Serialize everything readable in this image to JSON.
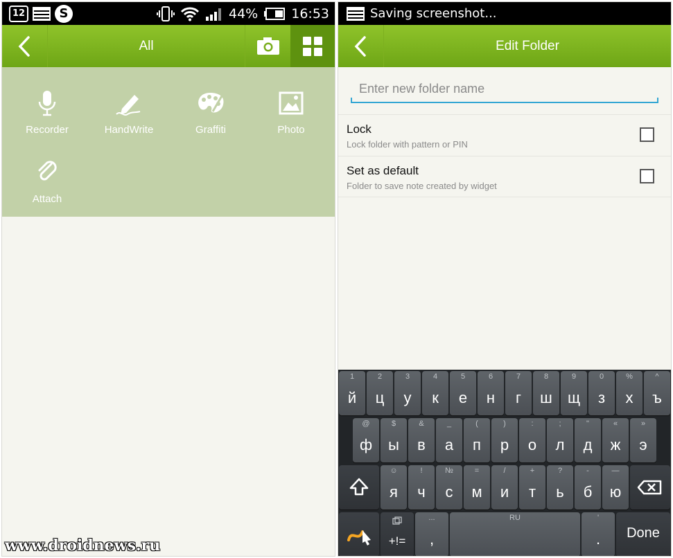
{
  "left": {
    "status": {
      "calendar_day": "12",
      "battery_percent": "44%",
      "time": "16:53",
      "s_icon_letter": "S"
    },
    "appbar": {
      "title": "All"
    },
    "tools": [
      {
        "label": "Recorder",
        "icon": "microphone-icon"
      },
      {
        "label": "HandWrite",
        "icon": "pen-icon"
      },
      {
        "label": "Graffiti",
        "icon": "palette-icon"
      },
      {
        "label": "Photo",
        "icon": "image-icon"
      },
      {
        "label": "Attach",
        "icon": "paperclip-icon"
      }
    ],
    "watermark": "www.droidnews.ru"
  },
  "right": {
    "status": {
      "text": "Saving screenshot..."
    },
    "appbar": {
      "title": "Edit Folder"
    },
    "folder_name": {
      "value": "",
      "placeholder": "Enter new folder name"
    },
    "options": [
      {
        "title": "Lock",
        "subtitle": "Lock folder with pattern or PIN",
        "checked": false
      },
      {
        "title": "Set as default",
        "subtitle": "Folder to save note created by widget",
        "checked": false
      }
    ],
    "keyboard": {
      "row1": [
        {
          "m": "й",
          "h": "1"
        },
        {
          "m": "ц",
          "h": "2"
        },
        {
          "m": "у",
          "h": "3"
        },
        {
          "m": "к",
          "h": "4"
        },
        {
          "m": "е",
          "h": "5"
        },
        {
          "m": "н",
          "h": "6"
        },
        {
          "m": "г",
          "h": "7"
        },
        {
          "m": "ш",
          "h": "8"
        },
        {
          "m": "щ",
          "h": "9"
        },
        {
          "m": "з",
          "h": "0"
        },
        {
          "m": "х",
          "h": "%"
        },
        {
          "m": "ъ",
          "h": "^"
        }
      ],
      "row2": [
        {
          "m": "ф",
          "h": "@"
        },
        {
          "m": "ы",
          "h": "$"
        },
        {
          "m": "в",
          "h": "&"
        },
        {
          "m": "а",
          "h": "_"
        },
        {
          "m": "п",
          "h": "("
        },
        {
          "m": "р",
          "h": ")"
        },
        {
          "m": "о",
          "h": ":"
        },
        {
          "m": "л",
          "h": ";"
        },
        {
          "m": "д",
          "h": "\""
        },
        {
          "m": "ж",
          "h": "«"
        },
        {
          "m": "э",
          "h": "»"
        }
      ],
      "row3": [
        {
          "m": "я",
          "h": "☺"
        },
        {
          "m": "ч",
          "h": "!"
        },
        {
          "m": "с",
          "h": "№"
        },
        {
          "m": "м",
          "h": "="
        },
        {
          "m": "и",
          "h": "/"
        },
        {
          "m": "т",
          "h": "+"
        },
        {
          "m": "ь",
          "h": "?"
        },
        {
          "m": "б",
          "h": "-"
        },
        {
          "m": "ю",
          "h": "—"
        }
      ],
      "symbols_label": "+!=",
      "comma": ",",
      "comma_hint": "...",
      "space_hint": "RU",
      "period": ".",
      "period_hint": "'",
      "done_label": "Done"
    }
  },
  "colors": {
    "accent_green": "#7bb31d",
    "tools_bg": "#c2d1a8",
    "field_underline": "#33a6d3"
  }
}
